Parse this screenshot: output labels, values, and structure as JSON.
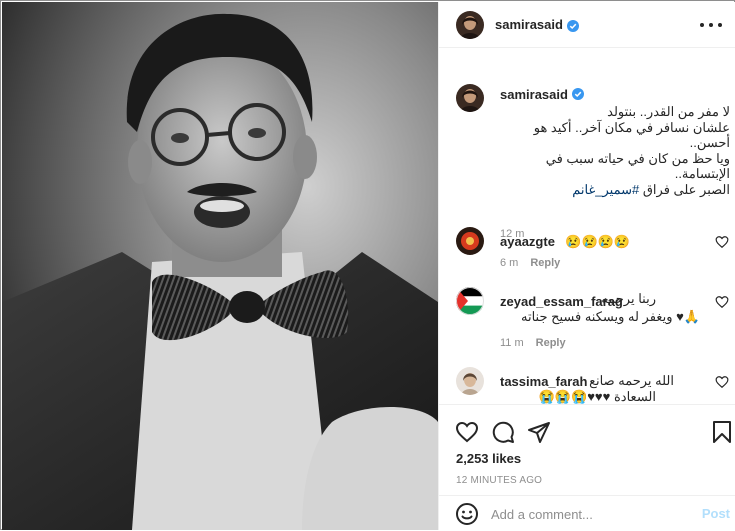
{
  "post": {
    "username": "samirasaid",
    "verified": true
  },
  "caption": {
    "username": "samirasaid",
    "lines": [
      "لا مفر من القدر.. بنتولد",
      "علشان نسافر في مكان آخر.. أكيد هو",
      "أحسن..",
      "ويا حظ من كان في حياته سبب في",
      "الإبتسامة..",
      "الصبر على فراق"
    ],
    "hashtag": "#سمير_غانم",
    "time": "12 m"
  },
  "comments": [
    {
      "username": "ayaazgte",
      "text": "😢😢😢😢",
      "time": "6 m",
      "reply": "Reply"
    },
    {
      "username": "zeyad_essam_farag",
      "lines": [
        "ربنا يرحمه",
        "🙏♥ ويغفر له ويسكنه فسيح جناته"
      ],
      "time": "11 m",
      "reply": "Reply"
    },
    {
      "username": "tassima_farah",
      "lines": [
        "الله يرحمه صانع",
        "السعادة ♥♥♥😭😭😭"
      ]
    }
  ],
  "stats": {
    "likes": "2,253 likes",
    "time_ago": "12 MINUTES AGO"
  },
  "compose": {
    "placeholder": "Add a comment...",
    "post_label": "Post"
  },
  "icons": [
    "more-icon",
    "verified-icon",
    "heart-icon",
    "comment-icon",
    "share-icon",
    "bookmark-icon",
    "emoji-icon"
  ],
  "colors": {
    "verified": "#3897f0",
    "hashtag": "#00376b",
    "muted": "#8e8e8e",
    "post_disabled": "#b2dffc"
  }
}
